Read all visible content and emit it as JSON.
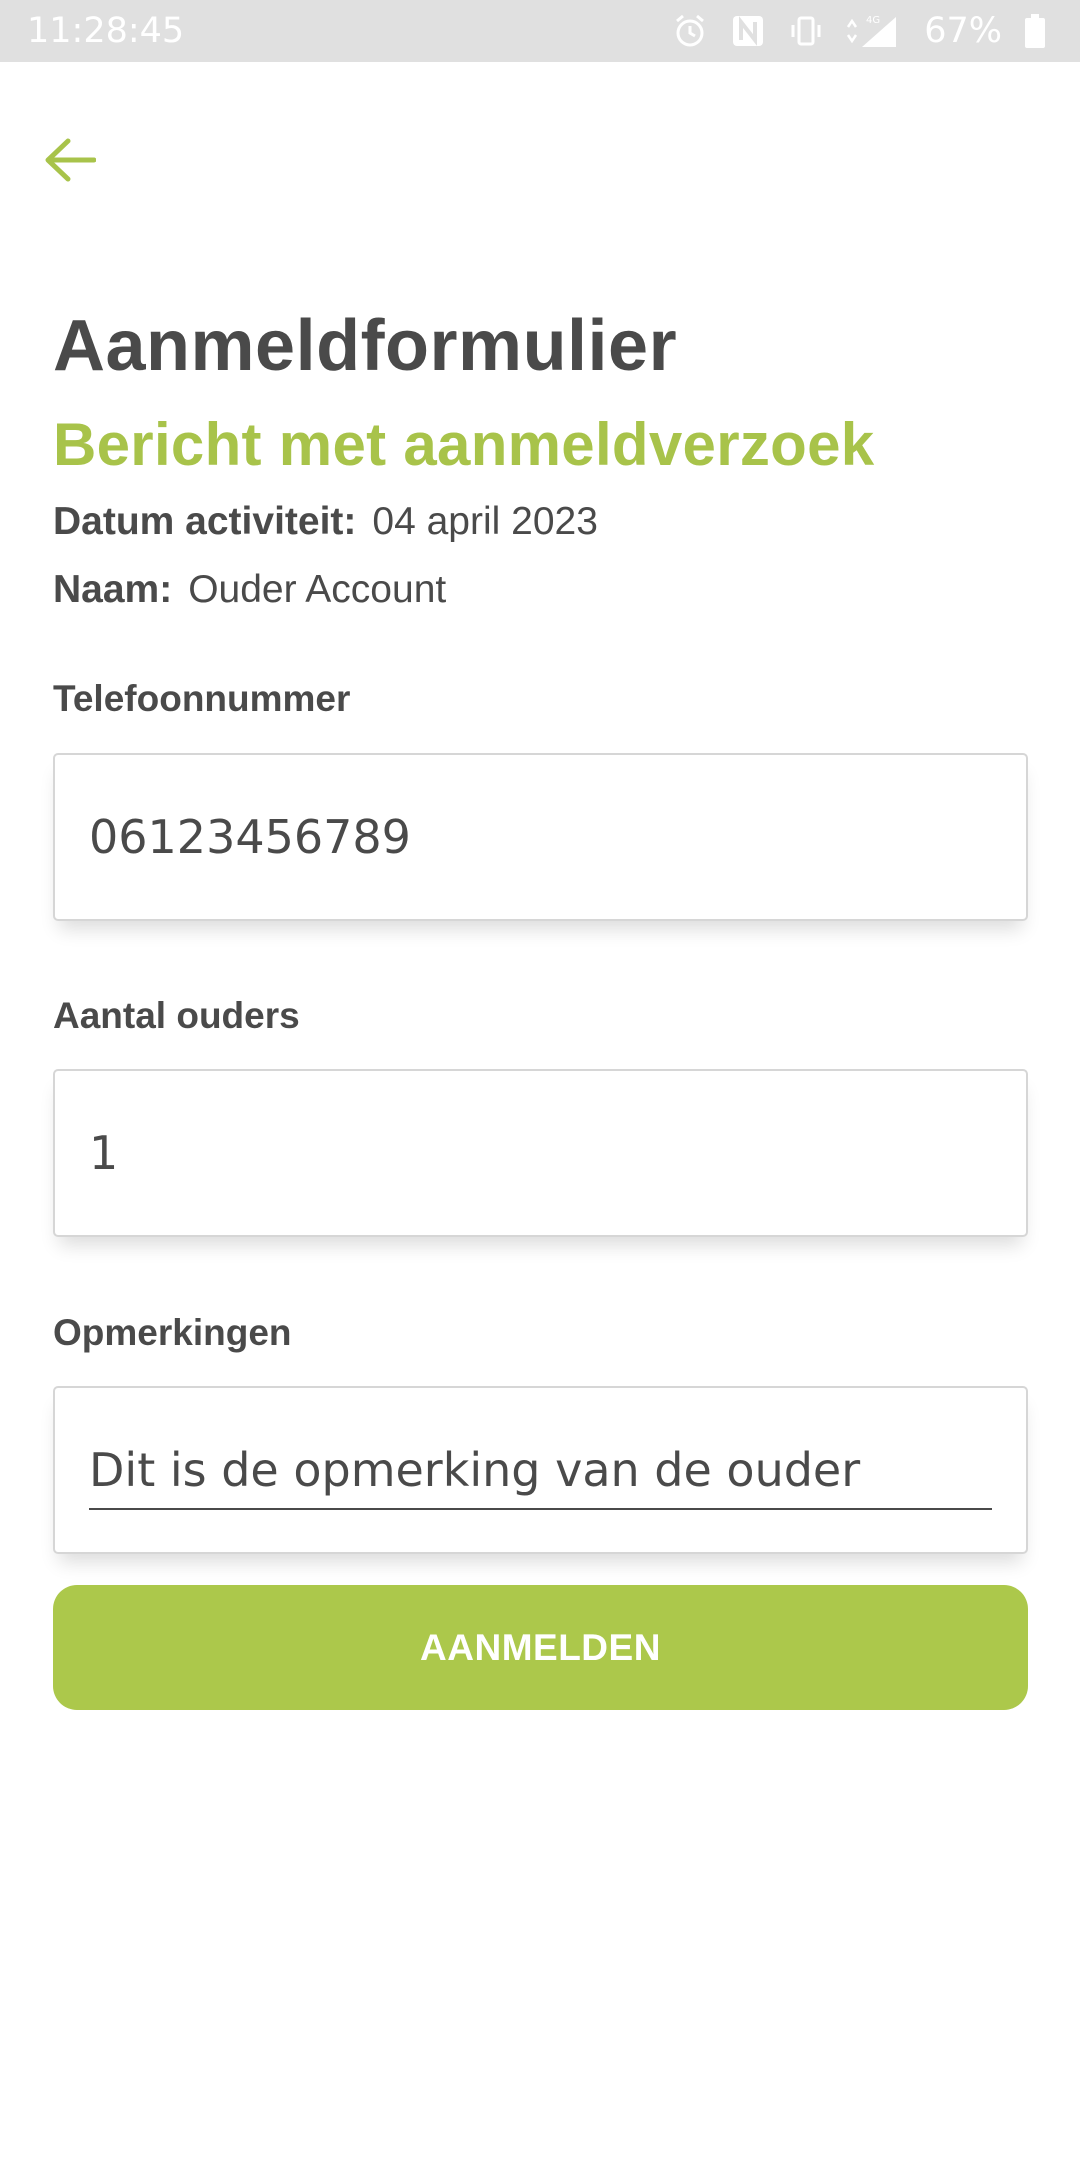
{
  "status_bar": {
    "time": "11:28:45",
    "battery": "67%",
    "network": "4G",
    "icons": [
      "alarm-icon",
      "nfc-icon",
      "vibrate-icon",
      "signal-icon",
      "battery-icon"
    ]
  },
  "header": {
    "back_icon": "arrow-left-icon"
  },
  "page": {
    "title": "Aanmeldformulier",
    "subtitle": "Bericht met aanmeldverzoek"
  },
  "info": {
    "date_label": "Datum activiteit:",
    "date_value": "04 april 2023",
    "name_label": "Naam:",
    "name_value": "Ouder Account"
  },
  "form": {
    "phone": {
      "label": "Telefoonnummer",
      "value": "06123456789"
    },
    "parents": {
      "label": "Aantal ouders",
      "value": "1"
    },
    "remarks": {
      "label": "Opmerkingen",
      "value": "Dit is de opmerking van de ouder"
    },
    "submit_label": "AANMELDEN"
  },
  "colors": {
    "accent": "#acc84b",
    "text": "#4a4a4a",
    "status_bar": "#e0e0e0"
  }
}
